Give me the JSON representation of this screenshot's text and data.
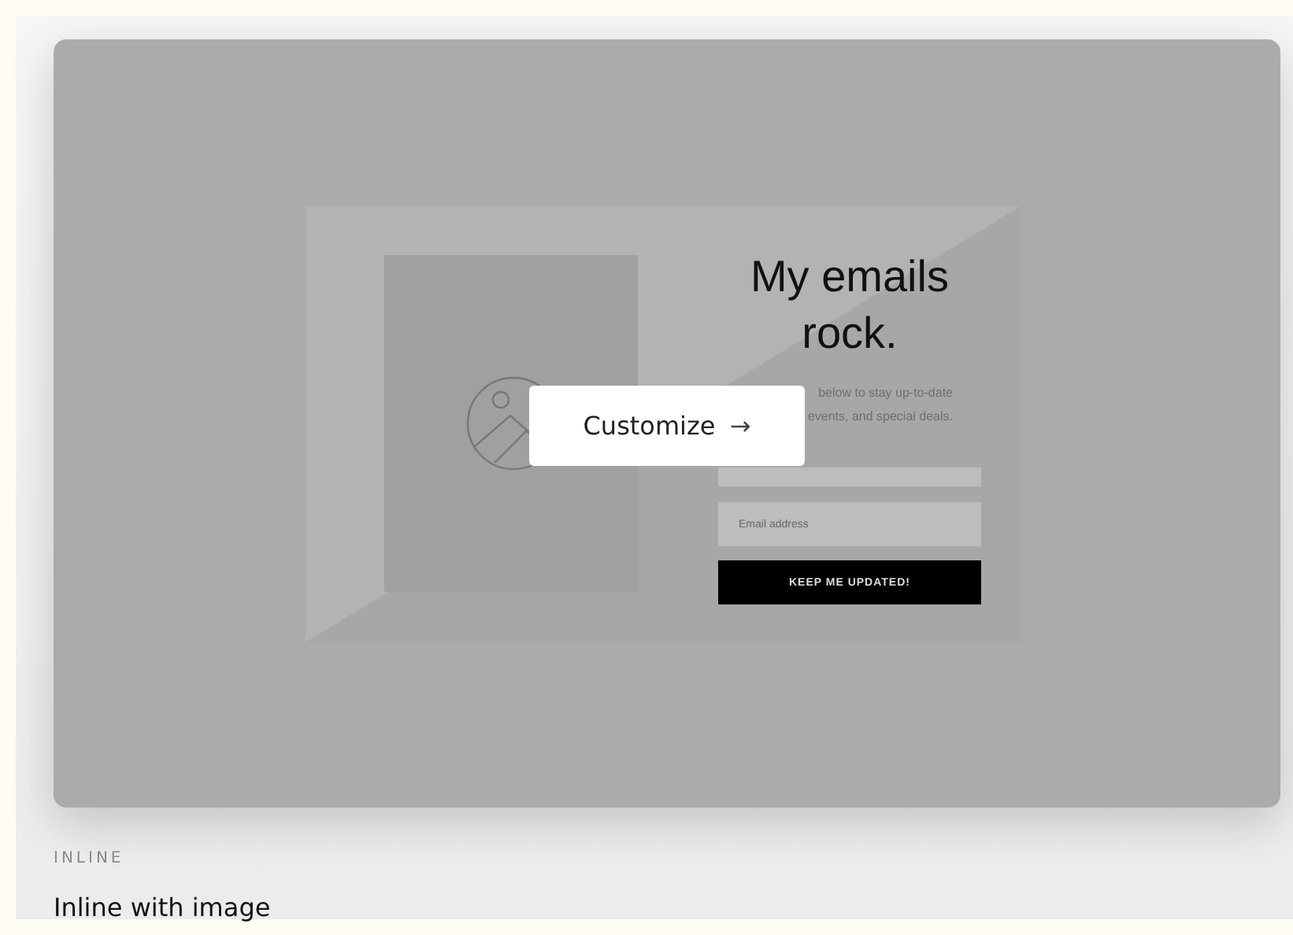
{
  "preview": {
    "title": "My emails rock.",
    "subtitle_lines": [
      "below to stay up-to-date",
      "events, and special deals."
    ],
    "fields": [
      {
        "kind": "text"
      },
      {
        "kind": "text",
        "placeholder": "Email address"
      }
    ],
    "submit": "KEEP ME UPDATED!"
  },
  "customize_button": {
    "label": "Customize",
    "icon": "→"
  },
  "category": "INLINE",
  "template_name": "Inline with image"
}
